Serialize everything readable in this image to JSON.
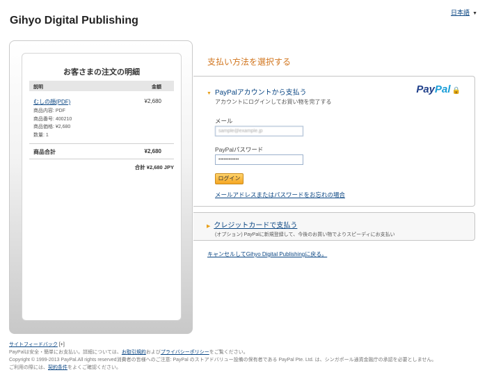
{
  "header": {
    "language": "日本語",
    "merchant_name": "Gihyo Digital Publishing"
  },
  "order": {
    "title": "お客さまの注文の明細",
    "col_description": "説明",
    "col_amount": "金額",
    "item": {
      "name": "むしの顔(PDF)",
      "price": "¥2,680",
      "details": [
        "商品内容: PDF",
        "商品番号: 400210",
        "商品価格: ¥2,680",
        "数量: 1"
      ]
    },
    "subtotal_label": "商品合計",
    "subtotal_value": "¥2,680",
    "total": "合計 ¥2,680 JPY"
  },
  "payment": {
    "choose_title": "支払い方法を選択する",
    "paypal_section": {
      "title": "PayPalアカウントから支払う",
      "subtitle": "アカウントにログインしてお買い物を完了する",
      "logo_pay": "Pay",
      "logo_pal": "Pal",
      "email_label": "メール",
      "email_value": "sample@example.jp",
      "password_label": "PayPalパスワード",
      "password_value": "••••••••••••",
      "login_button": "ログイン",
      "forgot_link": "メールアドレスまたはパスワードをお忘れの場合"
    },
    "credit_section": {
      "title": "クレジットカードで支払う",
      "subtitle": "(オプション) PayPalに新規登録して、今後のお買い物でよりスピーディにお支払い"
    },
    "cancel_link": "キャンセルしてGihyo Digital Publishingに戻る。"
  },
  "footer": {
    "feedback": "サイトフィードバック",
    "feedback_suffix": "[+]",
    "line1_a": "PayPalは安全・簡単にお支払い。詳細については、",
    "terms_link": "お取引規約",
    "line1_b": "および",
    "privacy_link": "プライバシーポリシー",
    "line1_c": "をご覧ください。",
    "line2": "Copyright © 1999-2013 PayPal.All rights reserved消費者の皆様へのご注意: PayPal のストアドバリュー設備の保有者である PayPal Pte. Ltd. は、シンガポール通貨金融庁の承認を必要としません。",
    "line3_a": "ご利用の際には、",
    "conditions_link": "契約条件",
    "line3_b": "をよくご確認ください。"
  }
}
